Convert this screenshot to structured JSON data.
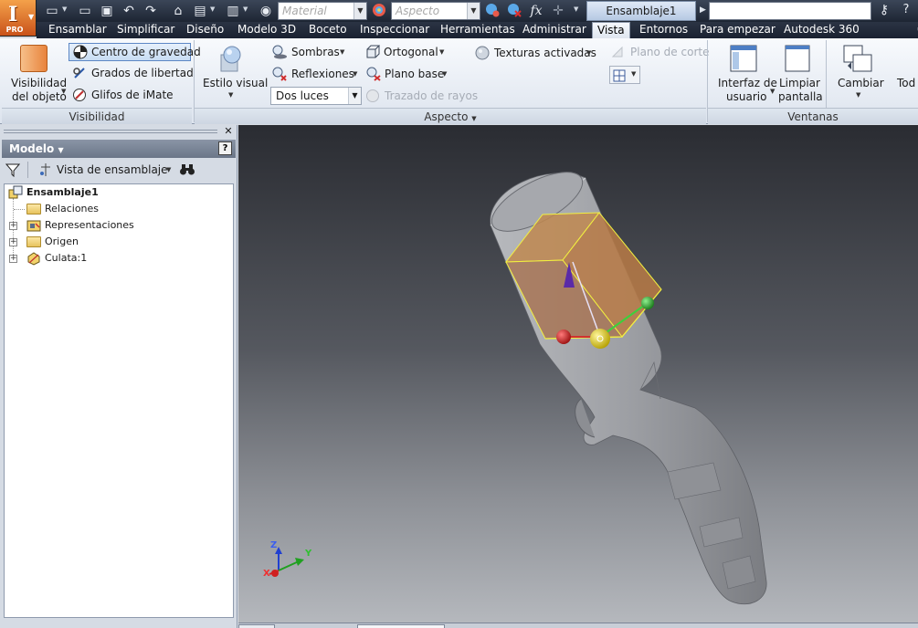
{
  "app": {
    "logo_letter": "I",
    "edition": "PRO",
    "document_title": "Ensamblaje1",
    "material_placeholder": "Material",
    "appearance_placeholder": "Aspecto",
    "fx_symbol": "fx"
  },
  "tabs": [
    {
      "label": "Ensamblar",
      "active": false
    },
    {
      "label": "Simplificar",
      "active": false
    },
    {
      "label": "Diseño",
      "active": false
    },
    {
      "label": "Modelo 3D",
      "active": false
    },
    {
      "label": "Boceto",
      "active": false
    },
    {
      "label": "Inspeccionar",
      "active": false
    },
    {
      "label": "Herramientas",
      "active": false
    },
    {
      "label": "Administrar",
      "active": false
    },
    {
      "label": "Vista",
      "active": true
    },
    {
      "label": "Entornos",
      "active": false
    },
    {
      "label": "Para empezar",
      "active": false
    },
    {
      "label": "Autodesk 360",
      "active": false
    }
  ],
  "ribbon": {
    "visibilidad": {
      "title": "Visibilidad",
      "object_visibility_line1": "Visibilidad",
      "object_visibility_line2": "del objeto",
      "center_of_gravity": "Centro de gravedad",
      "degrees_of_freedom": "Grados de libertad",
      "imate_glyphs": "Glifos de iMate"
    },
    "aspecto": {
      "title": "Aspecto",
      "visual_style": "Estilo visual",
      "shadows": "Sombras",
      "reflections": "Reflexiones",
      "lighting": "Dos luces",
      "orthographic": "Ortogonal",
      "ground_plane": "Plano base",
      "ray_tracing": "Trazado de rayos",
      "textures_on": "Texturas activadas",
      "section_plane": "Plano de corte"
    },
    "ventanas": {
      "title": "Ventanas",
      "user_interface_line1": "Interfaz de",
      "user_interface_line2": "usuario",
      "clean_screen_line1": "Limpiar",
      "clean_screen_line2": "pantalla",
      "switch": "Cambiar",
      "all": "Tod"
    }
  },
  "browser": {
    "title": "Modelo",
    "help_symbol": "?",
    "view_mode": "Vista de ensamblaje",
    "tree": [
      {
        "label": "Ensamblaje1",
        "icon": "assembly-icon",
        "expandable": false,
        "root": true
      },
      {
        "label": "Relaciones",
        "icon": "folder-icon",
        "expandable": false
      },
      {
        "label": "Representaciones",
        "icon": "representations-icon",
        "expandable": true
      },
      {
        "label": "Origen",
        "icon": "folder-icon",
        "expandable": true
      },
      {
        "label": "Culata:1",
        "icon": "part-icon",
        "expandable": true
      }
    ]
  },
  "viewport": {
    "triad_x": "X",
    "triad_y": "Y",
    "triad_z": "Z",
    "cog_box_color": "#c08850",
    "part_color": "#9a9ca1"
  }
}
